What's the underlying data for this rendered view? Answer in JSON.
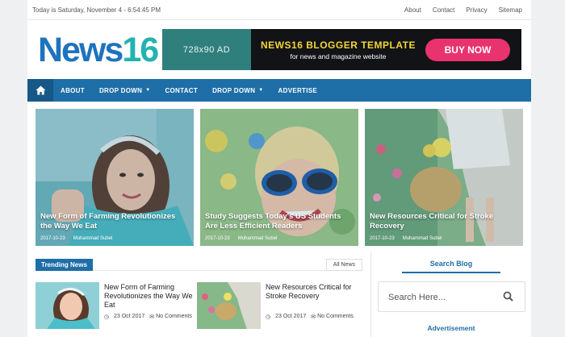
{
  "topbar": {
    "date": "Today is Saturday, November 4 - 6:54:45 PM",
    "links": [
      "About",
      "Contact",
      "Privacy",
      "Sitemap"
    ]
  },
  "logo": {
    "part1": "News",
    "part2": "16"
  },
  "ad": {
    "size": "728x90 AD",
    "headline": "NEWS16 BLOGGER TEMPLATE",
    "sub": "for news and magazine website",
    "button": "BUY NOW"
  },
  "nav": {
    "items": [
      {
        "label": "ABOUT",
        "dropdown": false
      },
      {
        "label": "DROP DOWN",
        "dropdown": true
      },
      {
        "label": "CONTACT",
        "dropdown": false
      },
      {
        "label": "DROP DOWN",
        "dropdown": true
      },
      {
        "label": "ADVERTISE",
        "dropdown": false
      }
    ]
  },
  "featured": [
    {
      "title": "New Form of Farming Revolutionizes the Way We Eat",
      "date": "2017-10-23",
      "author": "Muhammad Subel"
    },
    {
      "title": "Study Suggests Today's US Students Are Less Efficient Readers",
      "date": "2017-10-23",
      "author": "Muhammad Subel"
    },
    {
      "title": "New Resources Critical for Stroke Recovery",
      "date": "2017-10-23",
      "author": "Muhammad Subel"
    }
  ],
  "trending": {
    "label": "Trending News",
    "all": "All News",
    "posts": [
      {
        "title": "New Form of Farming Revolutionizes the Way We Eat",
        "date": "23 Oct 2017",
        "comments": "No Comments"
      },
      {
        "title": "New Resources Critical for Stroke Recovery",
        "date": "23 Oct 2017",
        "comments": "No Comments"
      }
    ]
  },
  "sidebar": {
    "search_title": "Search Blog",
    "search_placeholder": "Search Here...",
    "ad_title": "Advertisement"
  },
  "colors": {
    "accent": "#1e6ea7",
    "logo_blue": "#1e73be",
    "logo_teal": "#22b3b0",
    "buy": "#e8336e",
    "ad_yellow": "#f6d53b"
  }
}
